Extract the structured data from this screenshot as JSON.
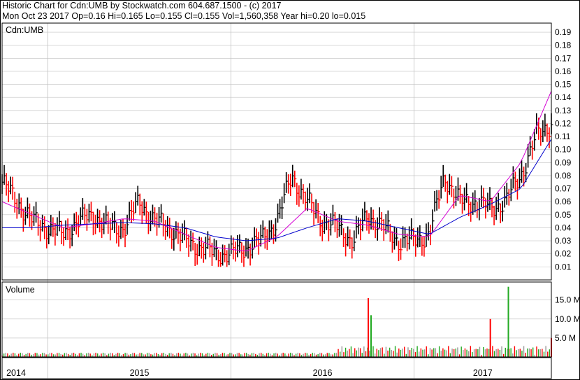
{
  "header": {
    "line1": "Historic Chart for Cdn:UMB by Stockwatch.com 604.687.1500 - (c) 2017",
    "line2": "Mon Oct 23 2017   Op=0.16   Hi=0.165   Lo=0.155   Cl=0.155   Vol=1,560,358   Year hi=0.20   lo=0.015"
  },
  "colors": {
    "frame": "#000000",
    "grid": "#c0c0c0",
    "price_bar": "#000000",
    "price_bar_down": "#ff0000",
    "ma_short": "#d400d4",
    "ma_long": "#0000cc",
    "vol_up": "#22aa22",
    "vol_down": "#ff0000",
    "vol_neutral": "#999999"
  },
  "chart_data": [
    {
      "type": "line",
      "panel": "price",
      "label": "Cdn:UMB",
      "ylim": [
        0.0,
        0.197
      ],
      "yticks": [
        "0.01",
        "0.02",
        "0.03",
        "0.04",
        "0.05",
        "0.06",
        "0.07",
        "0.08",
        "0.09",
        "0.10",
        "0.11",
        "0.12",
        "0.13",
        "0.14",
        "0.15",
        "0.16",
        "0.17",
        "0.18",
        "0.19"
      ],
      "xticks": [
        "2014",
        "2015",
        "2016",
        "2017"
      ],
      "x_range": [
        "2014-10",
        "2017-10"
      ],
      "series": [
        {
          "role": "price",
          "x": [
            "2014-10",
            "2014-11",
            "2014-12",
            "2015-01",
            "2015-02",
            "2015-03",
            "2015-04",
            "2015-05",
            "2015-06",
            "2015-07",
            "2015-08",
            "2015-09",
            "2015-10",
            "2015-11",
            "2015-12",
            "2016-01",
            "2016-02",
            "2016-03",
            "2016-04",
            "2016-05",
            "2016-06",
            "2016-07",
            "2016-08",
            "2016-09",
            "2016-10",
            "2016-11",
            "2016-12",
            "2017-01",
            "2017-02",
            "2017-03",
            "2017-04",
            "2017-05",
            "2017-06",
            "2017-07",
            "2017-08",
            "2017-09",
            "2017-10"
          ],
          "values": [
            0.075,
            0.06,
            0.045,
            0.04,
            0.035,
            0.045,
            0.05,
            0.04,
            0.04,
            0.06,
            0.045,
            0.04,
            0.03,
            0.025,
            0.02,
            0.02,
            0.025,
            0.03,
            0.045,
            0.08,
            0.06,
            0.045,
            0.04,
            0.03,
            0.05,
            0.04,
            0.03,
            0.03,
            0.035,
            0.08,
            0.06,
            0.06,
            0.055,
            0.06,
            0.08,
            0.11,
            0.12
          ]
        },
        {
          "role": "moving-average-short",
          "x": [
            "2014-10",
            "2014-12",
            "2015-02",
            "2015-04",
            "2015-06",
            "2015-08",
            "2015-10",
            "2015-12",
            "2016-02",
            "2016-04",
            "2016-06",
            "2016-08",
            "2016-10",
            "2016-12",
            "2017-02",
            "2017-04",
            "2017-06",
            "2017-08",
            "2017-10"
          ],
          "values": [
            0.06,
            0.05,
            0.04,
            0.043,
            0.047,
            0.045,
            0.035,
            0.025,
            0.022,
            0.033,
            0.055,
            0.045,
            0.042,
            0.035,
            0.033,
            0.065,
            0.06,
            0.09,
            0.145
          ]
        },
        {
          "role": "moving-average-long",
          "x": [
            "2014-10",
            "2014-12",
            "2015-02",
            "2015-04",
            "2015-06",
            "2015-08",
            "2015-10",
            "2015-12",
            "2016-02",
            "2016-04",
            "2016-06",
            "2016-08",
            "2016-10",
            "2016-12",
            "2017-02",
            "2017-04",
            "2017-06",
            "2017-08",
            "2017-10"
          ],
          "values": [
            0.04,
            0.04,
            0.042,
            0.043,
            0.044,
            0.043,
            0.04,
            0.033,
            0.03,
            0.032,
            0.04,
            0.047,
            0.045,
            0.04,
            0.035,
            0.048,
            0.058,
            0.07,
            0.108
          ]
        }
      ]
    },
    {
      "type": "bar",
      "panel": "volume",
      "label": "Volume",
      "ylim": [
        0,
        19000000
      ],
      "yticks": [
        "5.0 M",
        "10.0 M",
        "15.0 M"
      ],
      "peaks": [
        {
          "x": "2016-10",
          "value": 15500000,
          "color": "red"
        },
        {
          "x": "2016-10",
          "value": 11000000,
          "color": "green"
        },
        {
          "x": "2017-06",
          "value": 10000000,
          "color": "red"
        },
        {
          "x": "2017-07",
          "value": 18500000,
          "color": "green"
        },
        {
          "x": "2017-10",
          "value": 5000000,
          "color": "red"
        }
      ]
    }
  ]
}
